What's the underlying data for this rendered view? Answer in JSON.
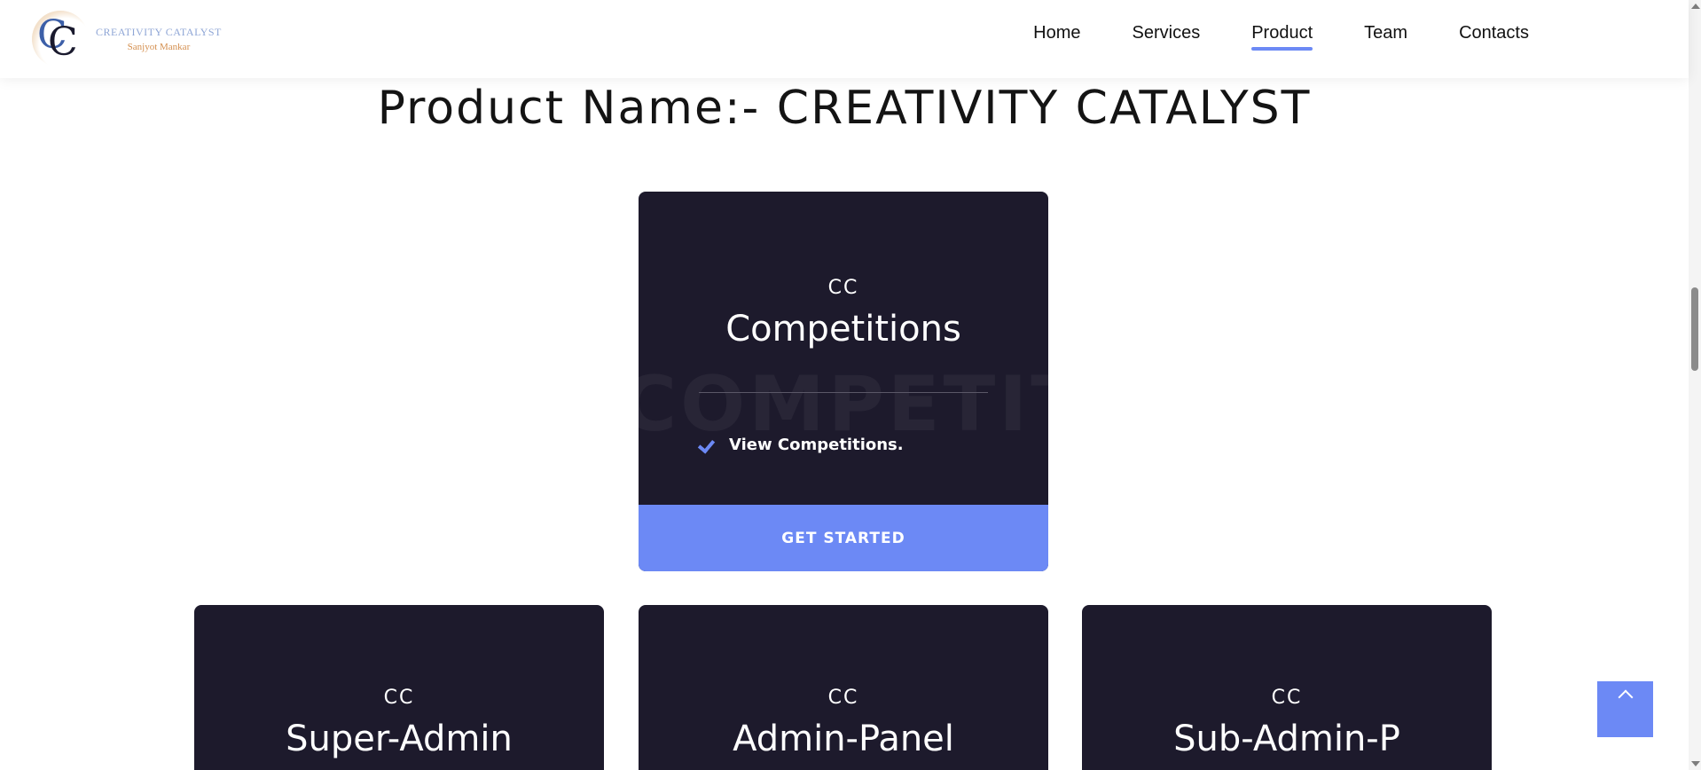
{
  "header": {
    "logo": {
      "mark": "CC",
      "title": "CREATIVITY CATALYST",
      "subtitle": "Sanjyot Mankar"
    },
    "nav": [
      {
        "label": "Home"
      },
      {
        "label": "Services"
      },
      {
        "label": "Product",
        "active": true
      },
      {
        "label": "Team"
      },
      {
        "label": "Contacts"
      }
    ]
  },
  "page_title": "Product Name:- CREATIVITY CATALYST",
  "cards": [
    {
      "tag": "CC",
      "name": "Competitions",
      "watermark": "COMPETITON",
      "feature": "View Competitions.",
      "cta": "GET STARTED"
    },
    {
      "tag": "CC",
      "name": "Super-Admin"
    },
    {
      "tag": "CC",
      "name": "Admin-Panel"
    },
    {
      "tag": "CC",
      "name": "Sub-Admin-P"
    }
  ],
  "colors": {
    "accent": "#6c89f5",
    "card_bg": "#1d1a2c"
  },
  "icons": {
    "feature_check": "check-icon",
    "back_to_top": "chevron-up-icon"
  }
}
